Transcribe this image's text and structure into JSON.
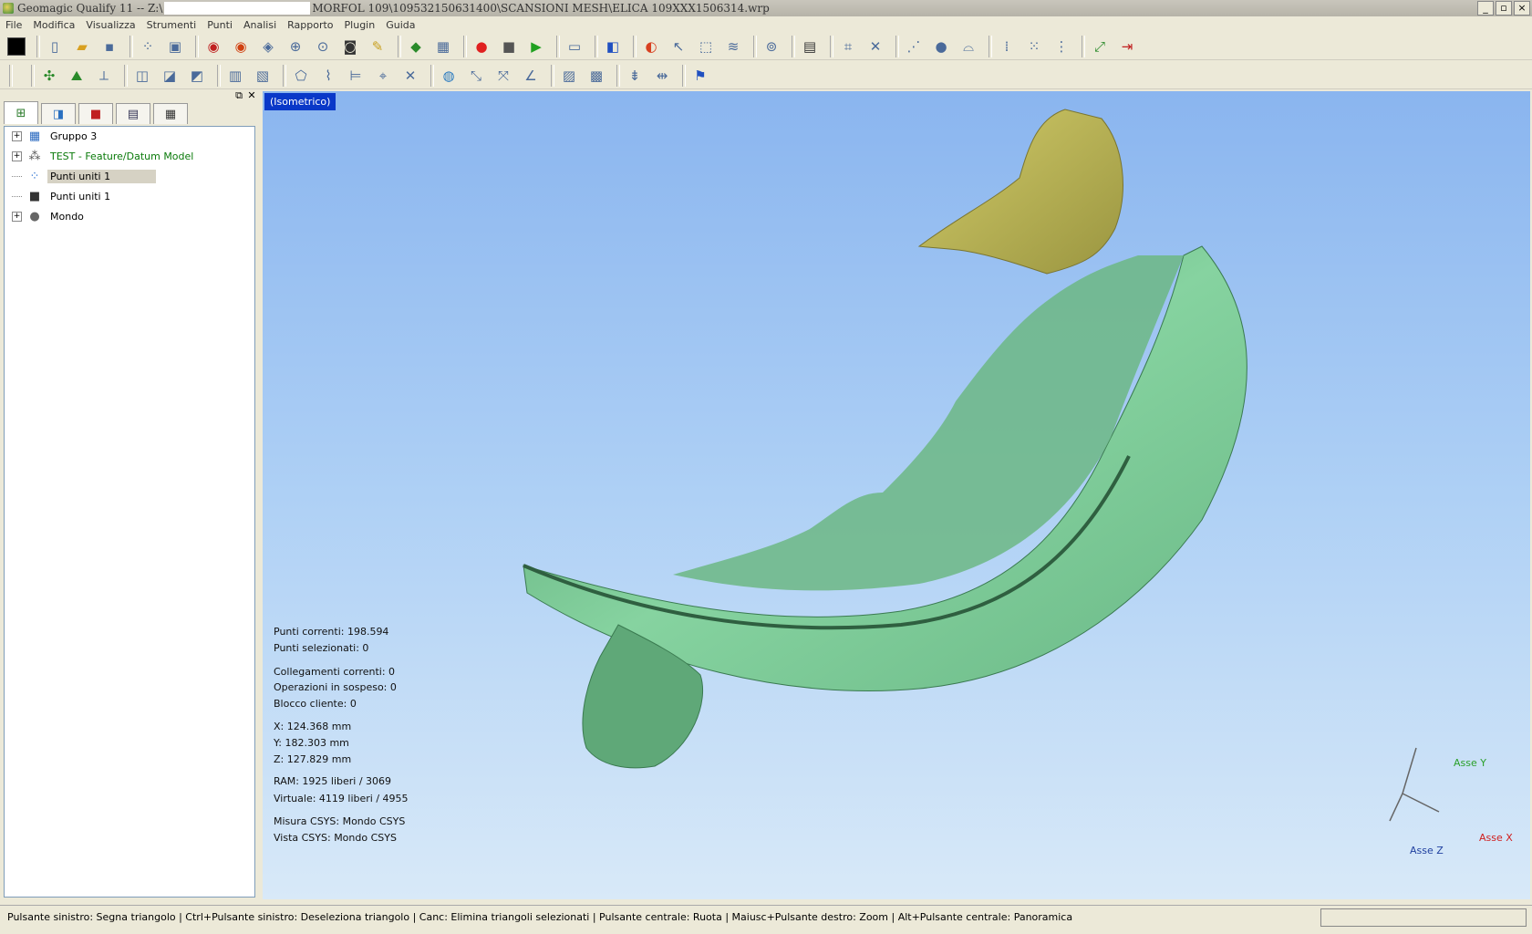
{
  "window": {
    "title_left": "Geomagic Qualify 11 -- Z:\\",
    "title_right": "MORFOL 109\\109532150631400\\SCANSIONI MESH\\ELICA 109XXX1506314.wrp",
    "buttons": [
      "_",
      "▫",
      "×"
    ]
  },
  "menu": [
    "File",
    "Modifica",
    "Visualizza",
    "Strumenti",
    "Punti",
    "Analisi",
    "Rapporto",
    "Plugin",
    "Guida"
  ],
  "panel": {
    "float_glyph": "⧉",
    "close_glyph": "✕",
    "tabs": [
      {
        "name": "model-manager-tab",
        "icon": "tree-icon"
      },
      {
        "name": "display-tab",
        "icon": "cube-icon"
      },
      {
        "name": "results-tab",
        "icon": "red-box-icon"
      },
      {
        "name": "report-tab",
        "icon": "printer-icon"
      },
      {
        "name": "grid-tab",
        "icon": "grid-icon"
      }
    ],
    "tree": [
      {
        "label": "Gruppo 3",
        "expander": "+",
        "icon": "group-icon",
        "color": "normal",
        "selected": false
      },
      {
        "label": "TEST - Feature/Datum Model",
        "expander": "+",
        "icon": "feature-model-icon",
        "color": "green",
        "selected": false
      },
      {
        "label": "Punti uniti 1",
        "expander": "",
        "icon": "point-cloud-icon",
        "color": "normal",
        "selected": true
      },
      {
        "label": "Punti uniti 1",
        "expander": "",
        "icon": "mesh-icon",
        "color": "normal",
        "selected": false
      },
      {
        "label": "Mondo",
        "expander": "+",
        "icon": "world-icon",
        "color": "normal",
        "selected": false
      }
    ]
  },
  "viewport": {
    "view_label": "(Isometrico)",
    "info": {
      "punti_correnti": "Punti correnti: 198.594",
      "punti_selezionati": "Punti selezionati: 0",
      "collegamenti": "Collegamenti correnti: 0",
      "operazioni": "Operazioni in sospeso: 0",
      "blocco": "Blocco cliente: 0",
      "x": "X: 124.368 mm",
      "y": "Y: 182.303 mm",
      "z": "Z: 127.829 mm",
      "ram": "RAM: 1925 liberi / 3069",
      "virtuale": "Virtuale: 4119 liberi / 4955",
      "misura_csys": "Misura CSYS: Mondo CSYS",
      "vista_csys": "Vista CSYS: Mondo CSYS"
    },
    "axes": {
      "y": "Asse Y",
      "x": "Asse X",
      "z": "Asse Z"
    },
    "colors": {
      "mesh": "#7fcf9a",
      "mesh_dark": "#3f7f55",
      "highlight": "#b7b35a",
      "bg_top": "#8ab5ef",
      "bg_bottom": "#d8e9f8"
    }
  },
  "status": {
    "hint": "Pulsante sinistro: Segna triangolo | Ctrl+Pulsante sinistro: Deseleziona triangolo | Canc: Elimina triangoli selezionati | Pulsante centrale: Ruota | Maiusc+Pulsante destro: Zoom | Alt+Pulsante centrale: Panoramica"
  }
}
